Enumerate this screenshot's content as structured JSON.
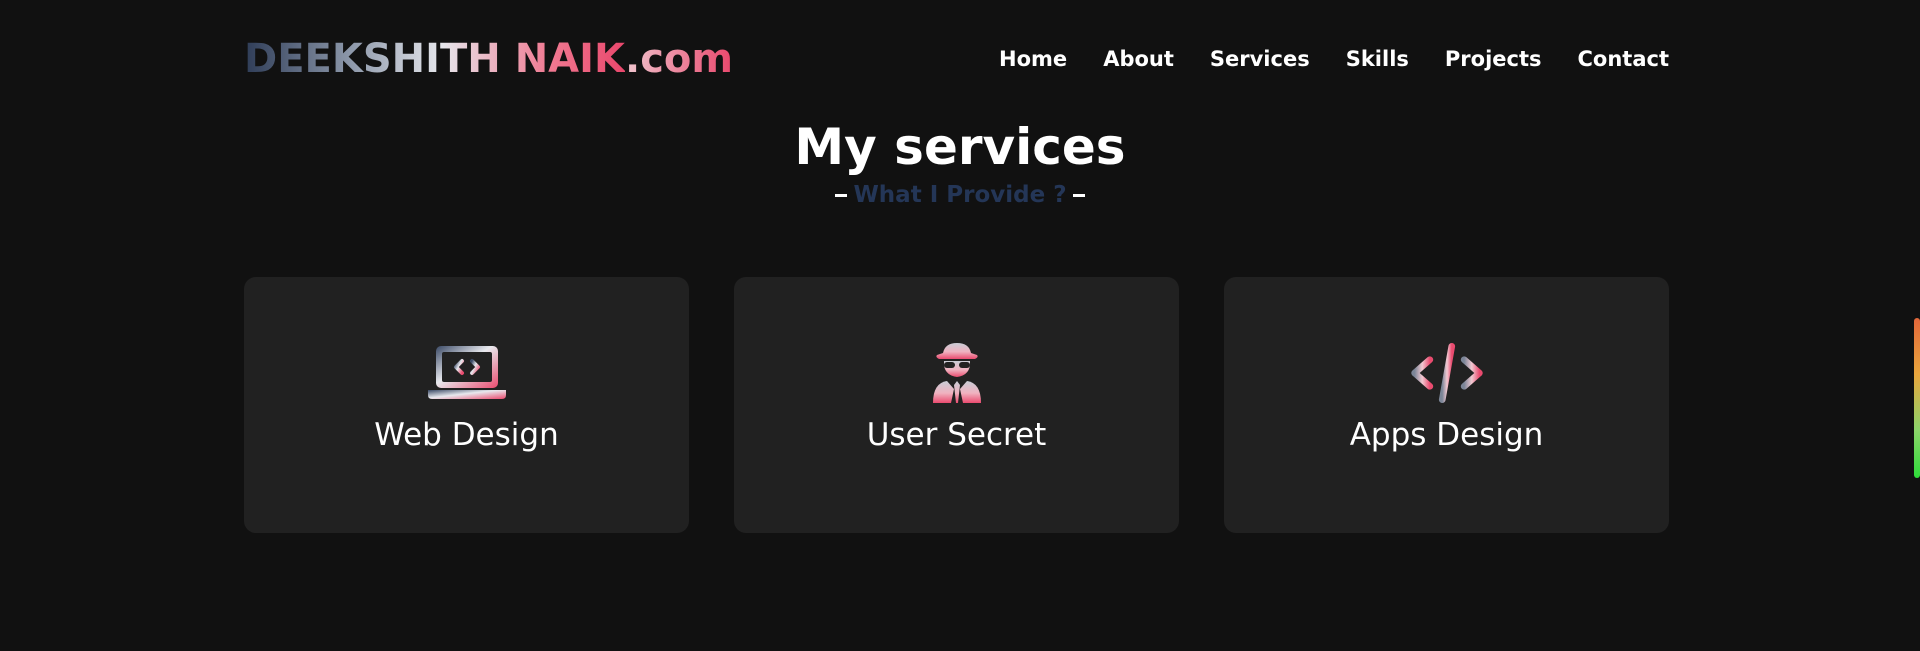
{
  "brand": {
    "name": "DEEKSHITH NAIK",
    "suffix": ".com"
  },
  "nav": {
    "items": [
      {
        "label": "Home"
      },
      {
        "label": "About"
      },
      {
        "label": "Services"
      },
      {
        "label": "Skills"
      },
      {
        "label": "Projects"
      },
      {
        "label": "Contact"
      }
    ]
  },
  "services": {
    "title": "My services",
    "subtitle": "What I Provide ?",
    "cards": [
      {
        "title": "Web Design",
        "icon": "laptop-code-icon"
      },
      {
        "title": "User Secret",
        "icon": "user-secret-icon"
      },
      {
        "title": "Apps Design",
        "icon": "code-icon"
      }
    ]
  },
  "colors": {
    "background": "#111111",
    "card": "#212121",
    "accent_pink": "#e9476c",
    "accent_navy": "#243657",
    "text": "#ffffff"
  }
}
